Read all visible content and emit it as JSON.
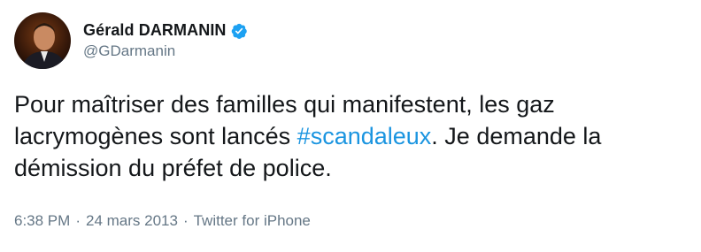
{
  "author": {
    "display_name": "Gérald DARMANIN",
    "handle": "@GDarmanin",
    "verified": true,
    "avatar_icon": "profile-photo",
    "verified_icon": "verified-badge-icon",
    "verified_color": "#1da1f2"
  },
  "tweet": {
    "text_part1": "Pour maîtriser des familles qui manifestent, les gaz lacrymogènes sont lancés ",
    "hashtag": "#scandaleux",
    "text_part2": ". Je demande la démission du préfet de police."
  },
  "meta": {
    "time": "6:38 PM",
    "date": "24 mars 2013",
    "separator": "·",
    "source": "Twitter for iPhone"
  },
  "colors": {
    "text": "#14171a",
    "secondary": "#657786",
    "link": "#1b95e0"
  }
}
